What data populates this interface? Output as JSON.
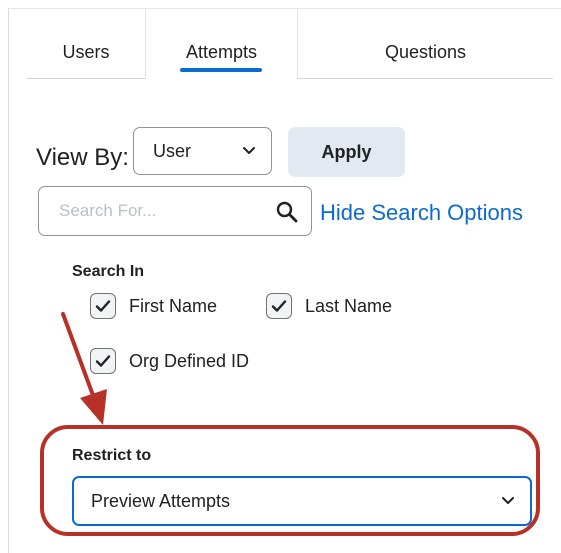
{
  "tabs": {
    "users": "Users",
    "attempts": "Attempts",
    "questions": "Questions",
    "active": "Attempts"
  },
  "view_by": {
    "label": "View By:",
    "selected": "User",
    "apply_label": "Apply"
  },
  "search": {
    "placeholder": "Search For...",
    "hide_options_label": "Hide Search Options"
  },
  "search_in": {
    "label": "Search In",
    "options": [
      {
        "label": "First Name",
        "checked": true
      },
      {
        "label": "Last Name",
        "checked": true
      },
      {
        "label": "Org Defined ID",
        "checked": true
      }
    ]
  },
  "restrict": {
    "label": "Restrict to",
    "selected": "Preview Attempts"
  },
  "colors": {
    "accent": "#0a6bd0",
    "annotation": "#b73128",
    "apply_bg": "#e3e9f1"
  },
  "icons": {
    "search": "magnifier-icon",
    "dropdown": "chevron-down-icon",
    "check": "checkmark-icon",
    "annotation_arrow": "red-arrow-icon"
  }
}
